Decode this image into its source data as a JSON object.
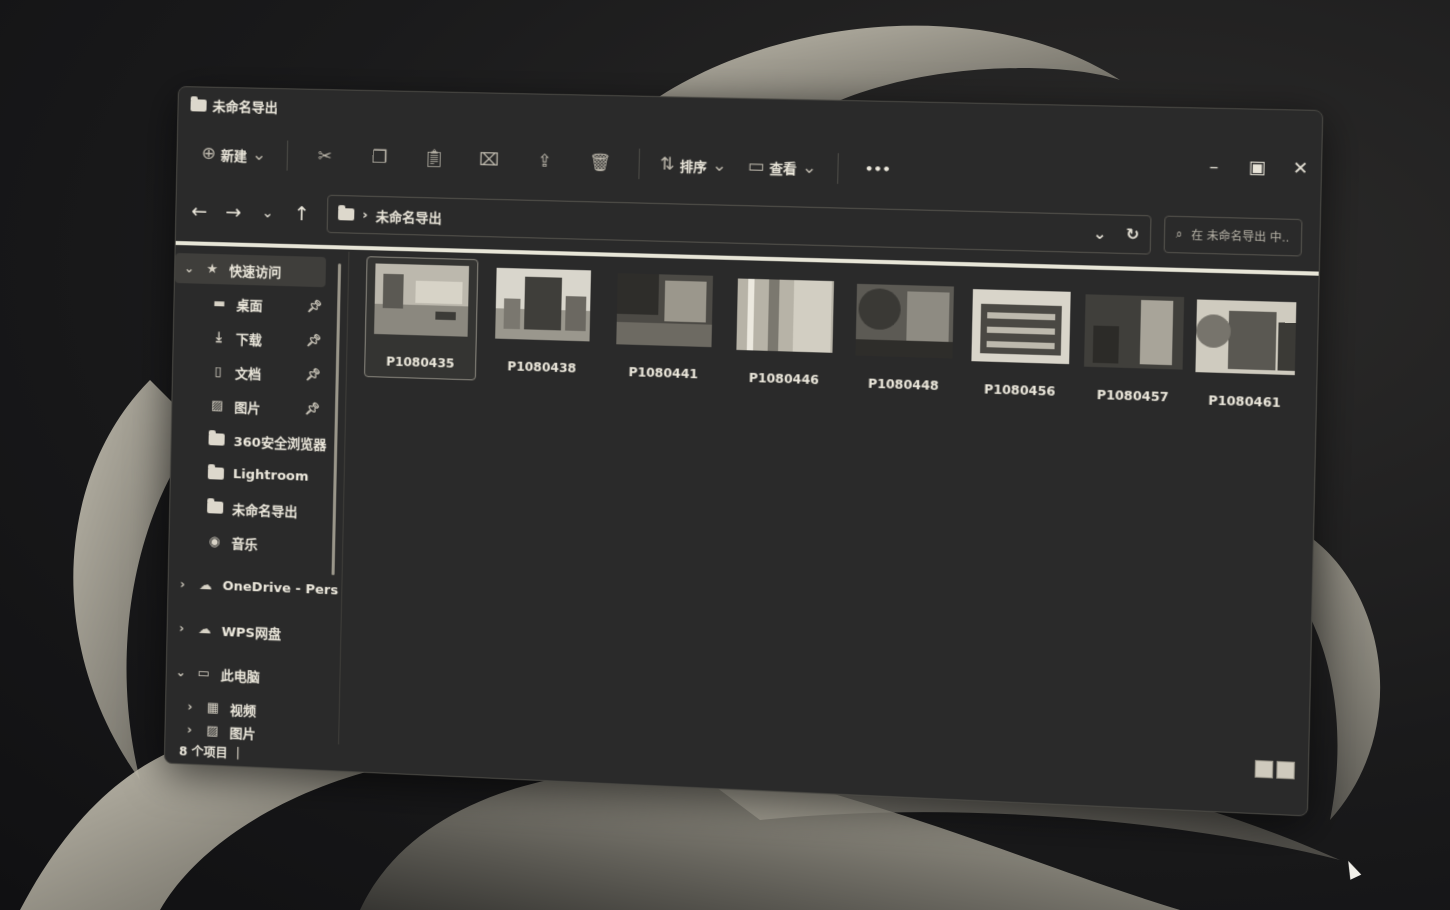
{
  "window": {
    "title": "未命名导出"
  },
  "toolbar": {
    "new_label": "新建",
    "sort_label": "排序",
    "view_label": "查看",
    "more_label": "•••"
  },
  "address": {
    "path": "未命名导出"
  },
  "search": {
    "placeholder": "在 未命名导出 中..."
  },
  "sidebar": {
    "quick_access": "快速访问",
    "items": [
      {
        "label": "桌面"
      },
      {
        "label": "下载"
      },
      {
        "label": "文档"
      },
      {
        "label": "图片"
      },
      {
        "label": "360安全浏览器"
      },
      {
        "label": "Lightroom"
      },
      {
        "label": "未命名导出"
      },
      {
        "label": "音乐"
      }
    ],
    "onedrive": "OneDrive - Pers",
    "wps": "WPS网盘",
    "this_pc": "此电脑",
    "videos": "视频",
    "pictures_partial": "图片"
  },
  "files": [
    {
      "name": "P1080435"
    },
    {
      "name": "P1080438"
    },
    {
      "name": "P1080441"
    },
    {
      "name": "P1080446"
    },
    {
      "name": "P1080448"
    },
    {
      "name": "P1080456"
    },
    {
      "name": "P1080457"
    },
    {
      "name": "P1080461"
    }
  ],
  "status": {
    "count": "8 个项目"
  }
}
